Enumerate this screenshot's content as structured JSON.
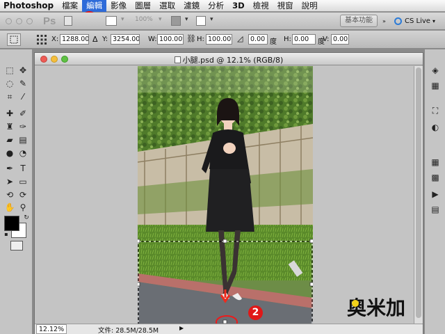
{
  "menubar": {
    "app_name": "Photoshop",
    "items": [
      "檔案",
      "編輯",
      "影像",
      "圖層",
      "選取",
      "濾鏡",
      "分析",
      "3D",
      "檢視",
      "視窗",
      "說明"
    ],
    "active_index": 1
  },
  "appbar": {
    "ps_label": "Ps",
    "zoom_value": "100%",
    "workspace_button": "基本功能",
    "cs_live": "CS Live"
  },
  "options": {
    "x_label": "X:",
    "x_value": "1288.00",
    "y_label": "Y:",
    "y_value": "3254.00",
    "w_label": "W:",
    "w_value": "100.00%",
    "h_label": "H:",
    "h_value": "100.00%",
    "angle_value": "0.00",
    "angle_unit": "度",
    "hskew_label": "H:",
    "hskew_value": "0.00",
    "hskew_unit": "度",
    "vskew_label": "V:",
    "vskew_value": "0.00"
  },
  "document": {
    "title": "小腿.psd @ 12.1% (RGB/8)",
    "zoom": "12.12%",
    "doc_size": "文件: 28.5M/28.5M"
  },
  "callouts": {
    "one": "1",
    "two": "2"
  },
  "watermark": {
    "text": "奥米加"
  },
  "colors": {
    "accent_menu": "#2e6bd9",
    "callout_red": "#e01818",
    "foreground": "#000000",
    "background": "#ffffff"
  }
}
